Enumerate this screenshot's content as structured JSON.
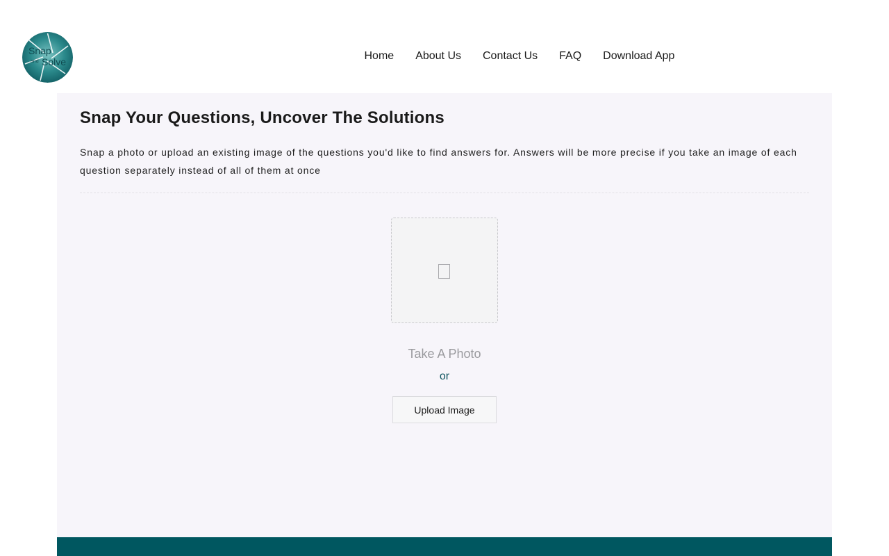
{
  "brand": {
    "logo_text_top": "Snap",
    "logo_text_mid": "and",
    "logo_text_bottom": "Solve",
    "primary_color": "#005760",
    "logo_color": "#1b7b80"
  },
  "nav": {
    "items": [
      {
        "label": "Home"
      },
      {
        "label": "About Us"
      },
      {
        "label": "Contact Us"
      },
      {
        "label": "FAQ"
      },
      {
        "label": "Download App"
      }
    ]
  },
  "main": {
    "title": "Snap Your Questions, Uncover The Solutions",
    "description": "Snap a photo or upload an existing image of the questions you'd like to find answers for. Answers will be more precise if you take an image of each question separately instead of all of them at once",
    "dropzone_icon": "image-placeholder-icon",
    "take_photo_label": "Take A Photo",
    "or_label": "or",
    "upload_label": "Upload Image"
  }
}
